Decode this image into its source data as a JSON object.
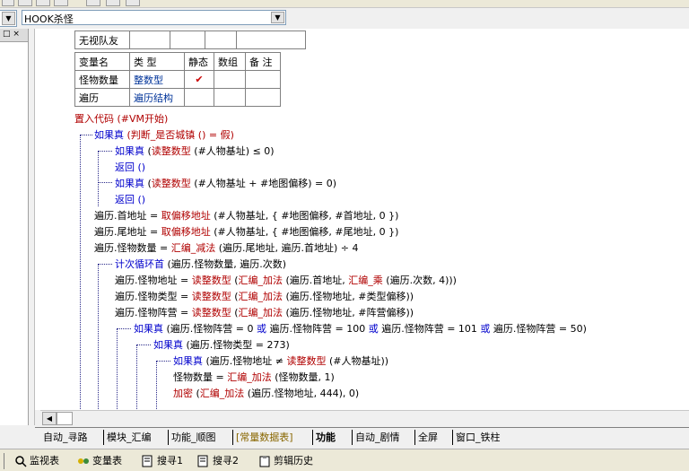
{
  "combo": {
    "selected": "HOOK杀怪"
  },
  "left_panel": {
    "header": "□ ×"
  },
  "table1": {
    "label": "无视队友"
  },
  "table2": {
    "headers": [
      "变量名",
      "类 型",
      "静态",
      "数组",
      "备 注"
    ],
    "rows": [
      {
        "name": "怪物数量",
        "type": "整数型",
        "static": "✔",
        "array": "",
        "note": ""
      },
      {
        "name": "遍历",
        "type": "遍历结构",
        "static": "",
        "array": "",
        "note": ""
      }
    ]
  },
  "code": {
    "l1": "置入代码 (#VM开始)",
    "l2a": "如果真",
    "l2b": " (判断_是否城镇 () = 假)",
    "l3a": "如果真",
    "l3b": " (",
    "l3c": "读整数型",
    "l3d": " (#人物基址) ≤ 0)",
    "l4": "返回 ()",
    "l5a": "如果真",
    "l5b": " (",
    "l5c": "读整数型",
    "l5d": " (#人物基址 + #地图偏移) = 0)",
    "l6": "返回 ()",
    "l7a": "遍历.首地址 = ",
    "l7b": "取偏移地址",
    "l7c": " (#人物基址, { #地图偏移, #首地址, 0 })",
    "l8a": "遍历.尾地址 = ",
    "l8b": "取偏移地址",
    "l8c": " (#人物基址, { #地图偏移, #尾地址, 0 })",
    "l9a": "遍历.怪物数量 = ",
    "l9b": "汇编_减法",
    "l9c": " (遍历.尾地址, 遍历.首地址) ÷ 4",
    "l10a": "计次循环首",
    "l10b": " (遍历.怪物数量, 遍历.次数)",
    "l11a": "遍历.怪物地址 = ",
    "l11b": "读整数型",
    "l11c": " (",
    "l11d": "汇编_加法",
    "l11e": " (遍历.首地址, ",
    "l11f": "汇编_乘",
    "l11g": " (遍历.次数, 4)))",
    "l12a": "遍历.怪物类型 = ",
    "l12b": "读整数型",
    "l12c": " (",
    "l12d": "汇编_加法",
    "l12e": " (遍历.怪物地址, #类型偏移))",
    "l13a": "遍历.怪物阵营 = ",
    "l13b": "读整数型",
    "l13c": " (",
    "l13d": "汇编_加法",
    "l13e": " (遍历.怪物地址, #阵营偏移))",
    "l14a": "如果真",
    "l14b": " (遍历.怪物阵营 = 0 ",
    "l14c": "或",
    "l14d": " 遍历.怪物阵营 = 100 ",
    "l14e": "或",
    "l14f": " 遍历.怪物阵营 = 101 ",
    "l14g": "或",
    "l14h": " 遍历.怪物阵营 = 50)",
    "l15a": "如果真",
    "l15b": " (遍历.怪物类型 = 273)",
    "l16a": "如果真",
    "l16b": " (遍历.怪物地址 ≠ ",
    "l16c": "读整数型",
    "l16d": " (#人物基址))",
    "l17a": "怪物数量 = ",
    "l17b": "汇编_加法",
    "l17c": " (怪物数量, 1)",
    "l18a": "加密",
    "l18b": " (",
    "l18c": "汇编_加法",
    "l18d": " (遍历.怪物地址, 444), 0)"
  },
  "tabs": [
    "自动_寻路",
    "模块_汇编",
    "功能_顺图",
    "[常量数据表]",
    "功能",
    "自动_剧情",
    "全屏",
    "窗口_铁柱"
  ],
  "bottom_tabs": [
    "监视表",
    "变量表",
    "搜寻1",
    "搜寻2",
    "剪辑历史"
  ],
  "colors": {
    "keyword": "#0000cc",
    "function": "#b00000",
    "type_link": "#003399",
    "check": "#cc0000"
  }
}
